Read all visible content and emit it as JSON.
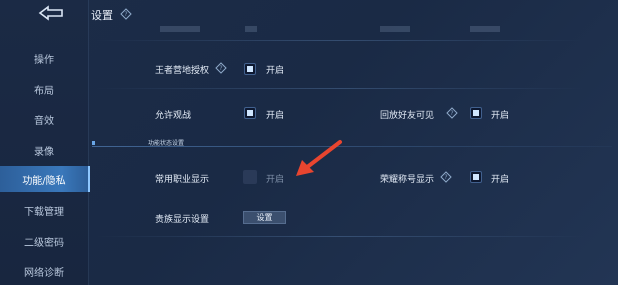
{
  "header": {
    "title": "设置"
  },
  "sidebar": {
    "items": [
      {
        "label": "操作",
        "active": false
      },
      {
        "label": "布局",
        "active": false
      },
      {
        "label": "音效",
        "active": false
      },
      {
        "label": "录像",
        "active": false
      },
      {
        "label": "功能/隐私",
        "active": true
      },
      {
        "label": "下载管理",
        "active": false
      },
      {
        "label": "二级密码",
        "active": false
      },
      {
        "label": "网络诊断",
        "active": false
      }
    ]
  },
  "settings": {
    "camp_auth": {
      "label": "王者营地授权",
      "state": "开启",
      "checked": true
    },
    "allow_watch": {
      "label": "允许观战",
      "state": "开启",
      "checked": true
    },
    "replay_friends": {
      "label": "回放好友可见",
      "state": "开启",
      "checked": true
    },
    "section_title": "功能状态设置",
    "common_job": {
      "label": "常用职业显示",
      "state": "开启",
      "checked": false
    },
    "honor_title": {
      "label": "荣耀称号显示",
      "state": "开启",
      "checked": true
    },
    "noble_display": {
      "label": "贵族显示设置",
      "button": "设置"
    }
  },
  "colors": {
    "accent": "#3a78bb",
    "arrow": "#e8452f"
  },
  "icons": {
    "back": "back-arrow-icon",
    "help": "help-diamond-icon"
  }
}
